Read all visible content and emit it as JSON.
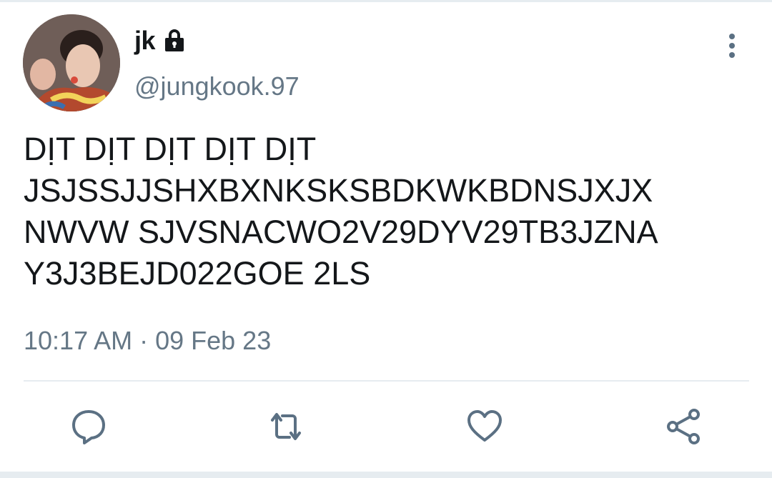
{
  "tweet": {
    "author": {
      "display_name": "jk",
      "handle": "@jungkook.97",
      "protected_icon": "lock-icon"
    },
    "text": "DỊT DỊT DỊT DỊT DỊT\nJSJSSJJSHXBXNKSKSBDKWKBDNSJXJX\nNWVW SJVSNACWO2V29DYV29TB3JZNA\nY3J3BEJD022GOE 2LS",
    "timestamp": "10:17 AM · 09 Feb 23"
  },
  "actions": {
    "icons": [
      "reply-icon",
      "retweet-icon",
      "like-icon",
      "share-icon"
    ]
  },
  "colors": {
    "text": "#14171a",
    "secondary": "#657786",
    "icon": "#5b7083",
    "divider": "#e6ecf0"
  }
}
